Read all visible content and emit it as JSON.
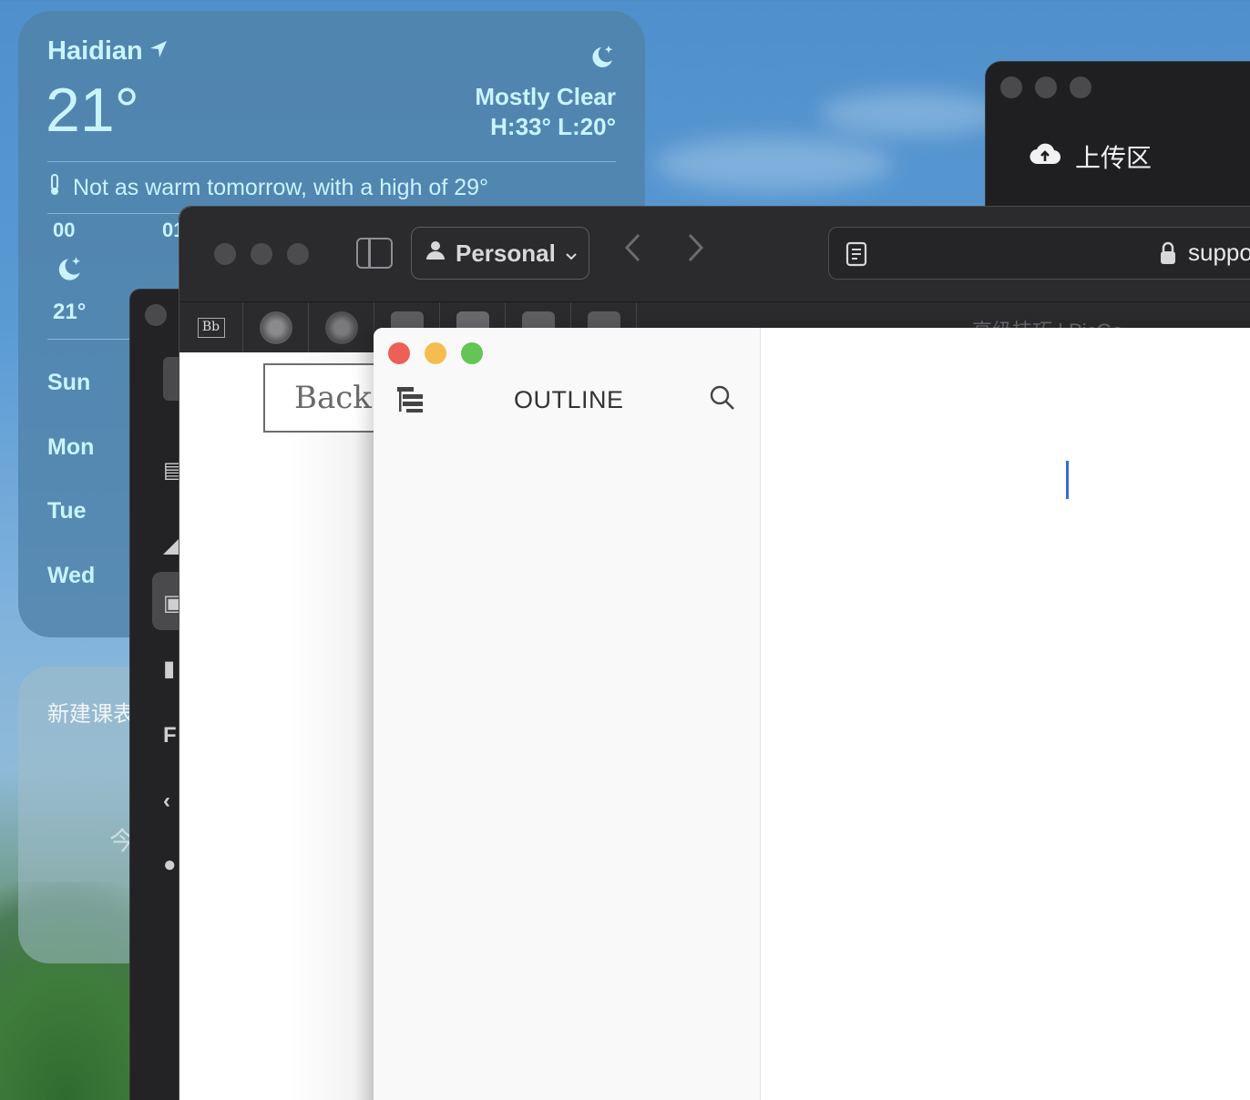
{
  "weather": {
    "city": "Haidian",
    "temperature": "21°",
    "condition": "Mostly Clear",
    "high_low": "H:33° L:20°",
    "note": "Not as warm tomorrow, with a high of 29°",
    "hourly": [
      {
        "hour": "00",
        "temp": "21°"
      },
      {
        "hour": "01",
        "temp": ""
      }
    ],
    "days": [
      "Sun",
      "Mon",
      "Tue",
      "Wed"
    ]
  },
  "widget2": {
    "title": "新建课表",
    "ghost_text": "今"
  },
  "upload_window": {
    "item_label": "上传区"
  },
  "browser": {
    "profile_label": "Personal",
    "url_host": "suppo",
    "favorite_partial_title": "高级技巧 | PicGo",
    "back_button_label": "Back"
  },
  "editor": {
    "sidebar_title": "OUTLINE"
  },
  "colors": {
    "close": "#ed5f57",
    "minimize": "#f5bd4f",
    "zoom": "#62c554",
    "caret": "#2f6de0"
  }
}
